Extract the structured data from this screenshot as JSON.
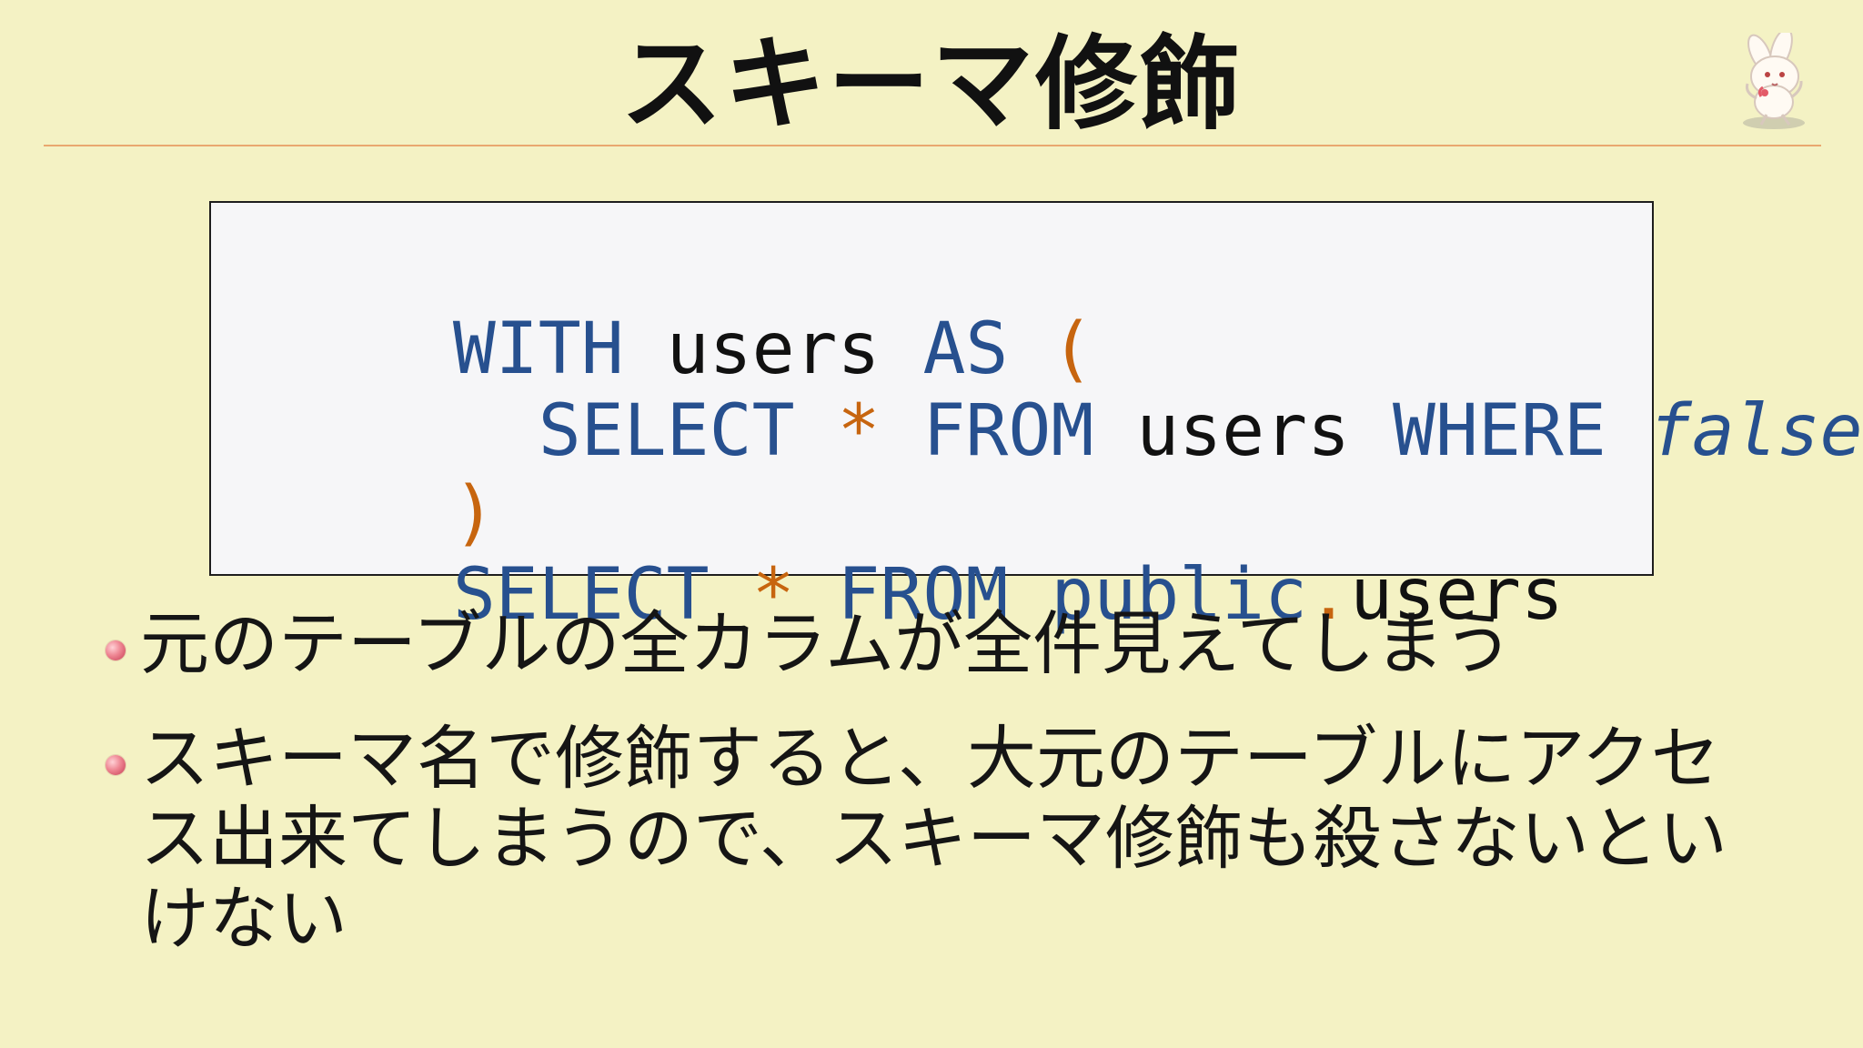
{
  "slide": {
    "title": "スキーマ修飾"
  },
  "mascot": {
    "icon": "rabbit-icon"
  },
  "code": {
    "lines": [
      {
        "tokens": [
          {
            "text": "WITH",
            "type": "keyword"
          },
          {
            "text": " ",
            "type": "plain"
          },
          {
            "text": "users",
            "type": "plain"
          },
          {
            "text": " ",
            "type": "plain"
          },
          {
            "text": "AS",
            "type": "keyword"
          },
          {
            "text": " ",
            "type": "plain"
          },
          {
            "text": "(",
            "type": "operator"
          }
        ]
      },
      {
        "tokens": [
          {
            "text": "  ",
            "type": "plain"
          },
          {
            "text": "SELECT",
            "type": "keyword"
          },
          {
            "text": " ",
            "type": "plain"
          },
          {
            "text": "*",
            "type": "operator"
          },
          {
            "text": " ",
            "type": "plain"
          },
          {
            "text": "FROM",
            "type": "keyword"
          },
          {
            "text": " ",
            "type": "plain"
          },
          {
            "text": "users",
            "type": "plain"
          },
          {
            "text": " ",
            "type": "plain"
          },
          {
            "text": "WHERE",
            "type": "keyword"
          },
          {
            "text": " ",
            "type": "plain"
          },
          {
            "text": "false",
            "type": "keyword_italic"
          }
        ]
      },
      {
        "tokens": [
          {
            "text": ")",
            "type": "operator"
          }
        ]
      },
      {
        "tokens": [
          {
            "text": "SELECT",
            "type": "keyword"
          },
          {
            "text": " ",
            "type": "plain"
          },
          {
            "text": "*",
            "type": "operator"
          },
          {
            "text": " ",
            "type": "plain"
          },
          {
            "text": "FROM",
            "type": "keyword"
          },
          {
            "text": " ",
            "type": "plain"
          },
          {
            "text": "public",
            "type": "keyword"
          },
          {
            "text": ".",
            "type": "operator"
          },
          {
            "text": "users",
            "type": "plain"
          }
        ]
      }
    ]
  },
  "bullets": [
    "元のテーブルの全カラムが全件見えてしまう",
    "スキーマ名で修飾すると、大元のテーブルにアクセス出来てしまうので、スキーマ修飾も殺さないといけない"
  ],
  "colors": {
    "background": "#f4f2c4",
    "keyword": "#27508f",
    "operator": "#c7650f",
    "title_rule": "#e9a86f",
    "bullet": "#ee8592"
  }
}
